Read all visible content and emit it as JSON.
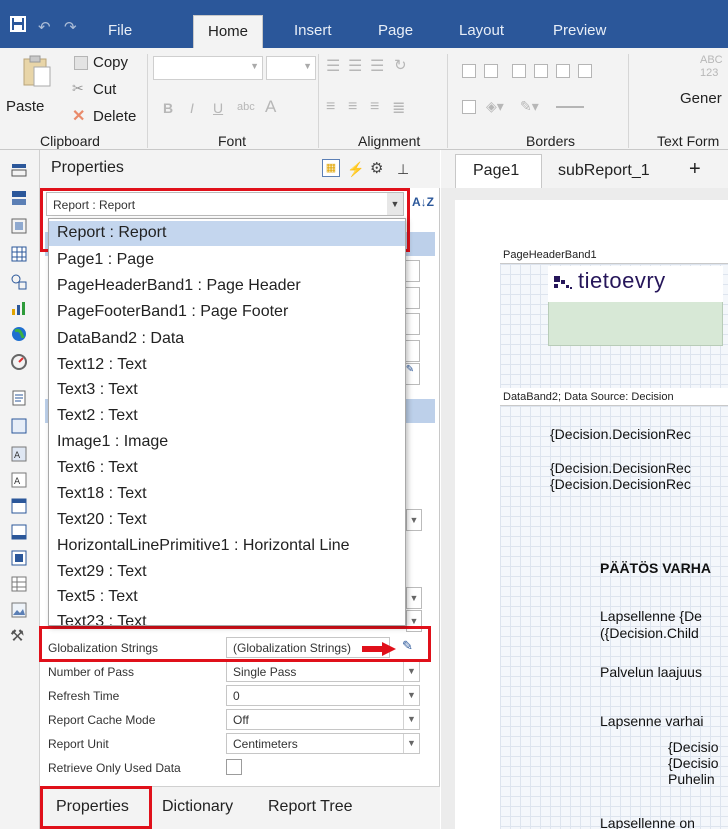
{
  "titlebar": {
    "tabs": [
      "File",
      "Home",
      "Insert",
      "Page",
      "Layout",
      "Preview"
    ],
    "active_tab": "Home"
  },
  "ribbon": {
    "copy": "Copy",
    "cut": "Cut",
    "paste": "Paste",
    "delete": "Delete",
    "groups": [
      "Clipboard",
      "Font",
      "Alignment",
      "Borders",
      "Text Form"
    ],
    "format_abc": "ABC",
    "format_123": "123",
    "format_general": "Gener",
    "bold": "B",
    "italic": "I",
    "underline": "U",
    "strike": "abc",
    "font_color": "A"
  },
  "properties": {
    "title": "Properties",
    "selector_value": "Report : Report",
    "sort_icon_text": "A↓Z",
    "dropdown_items": [
      "Report : Report",
      "Page1 : Page",
      "PageHeaderBand1 : Page Header",
      "PageFooterBand1 : Page Footer",
      "DataBand2 : Data",
      "Text12 : Text",
      "Text3 : Text",
      "Text2 : Text",
      "Image1 : Image",
      "Text6 : Text",
      "Text18 : Text",
      "Text20 : Text",
      "HorizontalLinePrimitive1 : Horizontal Line",
      "Text29 : Text",
      "Text5 : Text",
      "Text23 : Text"
    ],
    "rows": [
      {
        "name": "Globalization Strings",
        "value": "(Globalization Strings)"
      },
      {
        "name": "Number of Pass",
        "value": "Single Pass"
      },
      {
        "name": "Refresh Time",
        "value": "0"
      },
      {
        "name": "Report Cache Mode",
        "value": "Off"
      },
      {
        "name": "Report Unit",
        "value": "Centimeters"
      },
      {
        "name": "Retrieve Only Used Data",
        "value": ""
      }
    ],
    "bottom_tabs": [
      "Properties",
      "Dictionary",
      "Report Tree"
    ]
  },
  "designer": {
    "page_tabs": [
      "Page1",
      "subReport_1",
      "+"
    ],
    "header_band": "PageHeaderBand1",
    "logo_text": "tietoevry",
    "data_band": "DataBand2; Data Source: Decision",
    "texts": [
      "{Decision.DecisionRec",
      "{Decision.DecisionRec",
      "{Decision.DecisionRec",
      "PÄÄTÖS VARHA",
      "Lapsellenne {De",
      "({Decision.Child",
      "Palvelun laajuus",
      "Lapsenne varhai",
      "{Decisio",
      "{Decisio",
      "Puhelin",
      "Lapsellenne on"
    ]
  },
  "colors": {
    "accent": "#2b579a",
    "highlight": "#c4d6ee",
    "annotation": "#e0101a"
  }
}
